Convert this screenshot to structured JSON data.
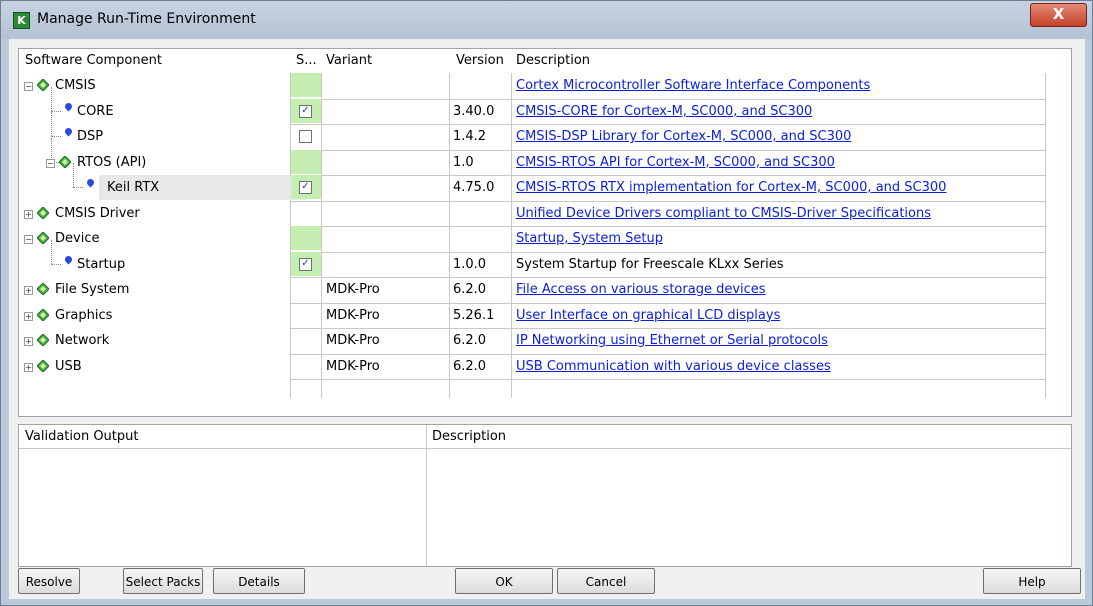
{
  "window": {
    "title": "Manage Run-Time Environment",
    "close_label": "X"
  },
  "columns": {
    "component": "Software Component",
    "sel": "S...",
    "variant": "Variant",
    "version": "Version",
    "description": "Description"
  },
  "rows": [
    {
      "name": "CMSIS",
      "level": 0,
      "expander": "-",
      "icon": "green-diamond-icon",
      "sel": "green",
      "checked": false,
      "variant": "",
      "version": "",
      "description": "Cortex Microcontroller Software Interface Components",
      "link": true
    },
    {
      "name": "CORE",
      "level": 1,
      "icon": "blue-bullet-icon",
      "sel": "check",
      "checked": true,
      "variant": "",
      "version": "3.40.0",
      "description": "CMSIS-CORE for Cortex-M, SC000, and SC300",
      "link": true
    },
    {
      "name": "DSP",
      "level": 1,
      "icon": "blue-bullet-icon",
      "sel": "check",
      "checked": false,
      "variant": "",
      "version": "1.4.2",
      "description": "CMSIS-DSP Library for Cortex-M, SC000, and SC300",
      "link": true
    },
    {
      "name": "RTOS (API)",
      "level": 1,
      "expander": "-",
      "icon": "green-diamond-icon",
      "sel": "green",
      "checked": false,
      "variant": "",
      "version": "1.0",
      "description": "CMSIS-RTOS API for Cortex-M, SC000, and SC300",
      "link": true
    },
    {
      "name": "Keil RTX",
      "level": 2,
      "icon": "blue-bullet-icon",
      "sel": "check",
      "checked": true,
      "selected": true,
      "variant": "",
      "version": "4.75.0",
      "description": "CMSIS-RTOS RTX implementation for Cortex-M, SC000, and SC300",
      "link": true
    },
    {
      "name": "CMSIS Driver",
      "level": 0,
      "expander": "+",
      "icon": "green-diamond-icon",
      "sel": "none",
      "checked": false,
      "variant": "",
      "version": "",
      "description": "Unified Device Drivers compliant to CMSIS-Driver Specifications",
      "link": true
    },
    {
      "name": "Device",
      "level": 0,
      "expander": "-",
      "icon": "green-diamond-icon",
      "sel": "green",
      "checked": false,
      "variant": "",
      "version": "",
      "description": "Startup, System Setup",
      "link": true
    },
    {
      "name": "Startup",
      "level": 1,
      "icon": "blue-bullet-icon",
      "sel": "check",
      "checked": true,
      "variant": "",
      "version": "1.0.0",
      "description": "System Startup for Freescale KLxx Series",
      "link": false
    },
    {
      "name": "File System",
      "level": 0,
      "expander": "+",
      "icon": "green-diamond-icon",
      "sel": "none",
      "checked": false,
      "variant": "MDK-Pro",
      "version": "6.2.0",
      "description": "File Access on various storage devices",
      "link": true
    },
    {
      "name": "Graphics",
      "level": 0,
      "expander": "+",
      "icon": "green-diamond-icon",
      "sel": "none",
      "checked": false,
      "variant": "MDK-Pro",
      "version": "5.26.1",
      "description": "User Interface on graphical LCD displays",
      "link": true
    },
    {
      "name": "Network",
      "level": 0,
      "expander": "+",
      "icon": "green-diamond-icon",
      "sel": "none",
      "checked": false,
      "variant": "MDK-Pro",
      "version": "6.2.0",
      "description": "IP Networking using Ethernet or Serial protocols",
      "link": true
    },
    {
      "name": "USB",
      "level": 0,
      "expander": "+",
      "icon": "green-diamond-icon",
      "sel": "none",
      "checked": false,
      "variant": "MDK-Pro",
      "version": "6.2.0",
      "description": "USB Communication with various device classes",
      "link": true
    }
  ],
  "validation": {
    "output_header": "Validation Output",
    "description_header": "Description"
  },
  "buttons": {
    "resolve": "Resolve",
    "select_packs": "Select Packs",
    "details": "Details",
    "ok": "OK",
    "cancel": "Cancel",
    "help": "Help"
  },
  "colors": {
    "selection_green": "#c5efb2",
    "link_blue": "#0a1fd8",
    "window_frame": "#bcc9d8"
  }
}
